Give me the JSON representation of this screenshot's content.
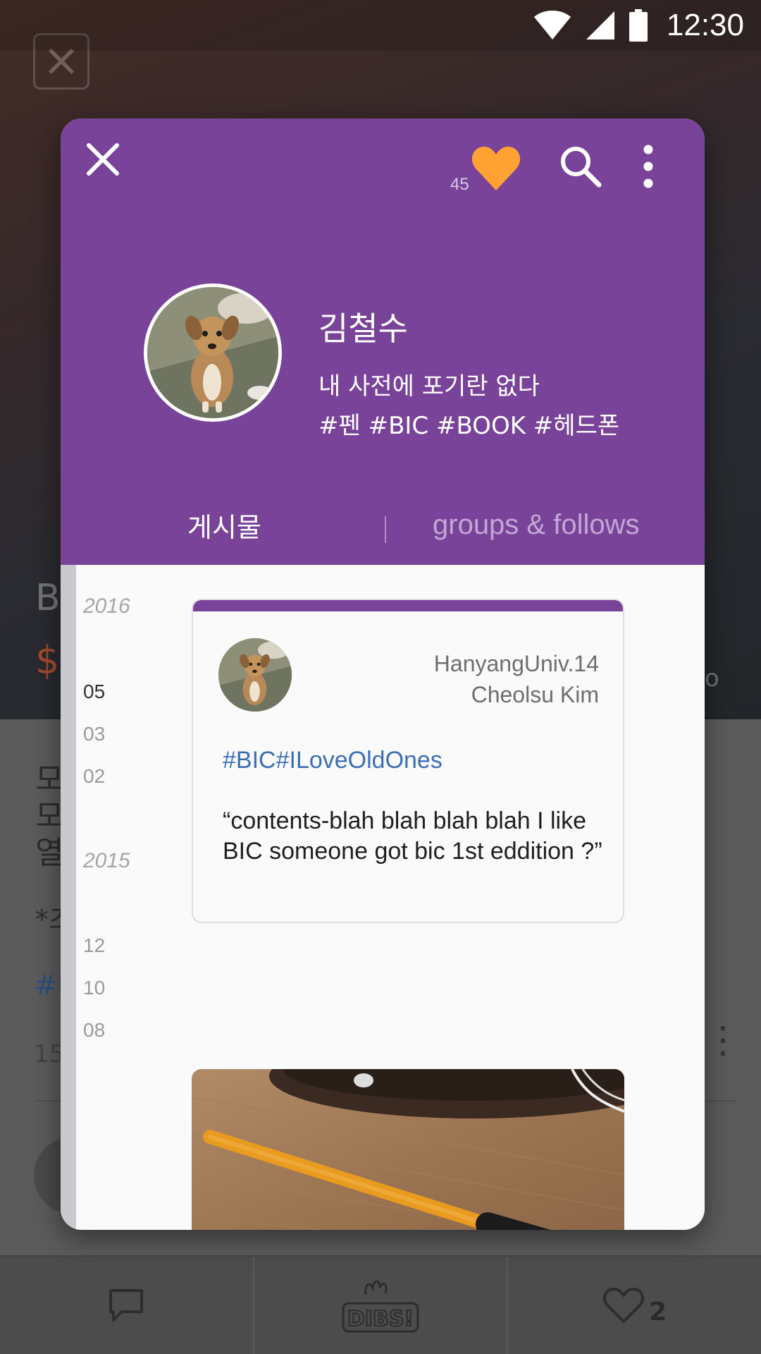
{
  "status_bar": {
    "time": "12:30"
  },
  "background": {
    "title_partial": "BI",
    "price_partial": "$(",
    "side_text_partial": "o",
    "text_lines": [
      "모",
      "모",
      "열"
    ],
    "note_partial": "*즈",
    "hashtag_partial": "#E",
    "meta_partial": "15",
    "bottom_bar": {
      "like_count": "2"
    }
  },
  "profile": {
    "likes_count": "45",
    "name": "김철수",
    "bio": "내 사전에 포기란 없다",
    "tags": "#펜 #BIC #BOOK #헤드폰",
    "tabs": [
      {
        "label": "게시물",
        "active": true
      },
      {
        "label": "groups & follows",
        "active": false
      }
    ]
  },
  "timeline": {
    "years": [
      "2016",
      "2015"
    ],
    "months_2016": [
      "05",
      "03",
      "02"
    ],
    "months_2015": [
      "12",
      "10",
      "08"
    ],
    "active_month": "05"
  },
  "post": {
    "author_school": "HanyangUniv.14",
    "author_name": "Cheolsu Kim",
    "hashtags": "#BIC#ILoveOldOnes",
    "text": " “contents-blah blah blah blah I like BIC someone got bic 1st eddition ?”"
  },
  "colors": {
    "header_purple": "#784399",
    "heart_orange": "#FFA233",
    "hashtag_blue": "#3B6FB4"
  },
  "icons": [
    "close-icon",
    "heart-icon",
    "search-icon",
    "more-vert-icon",
    "wifi-icon",
    "signal-icon",
    "battery-icon",
    "comment-icon",
    "dibs-logo",
    "heart-outline-icon"
  ]
}
